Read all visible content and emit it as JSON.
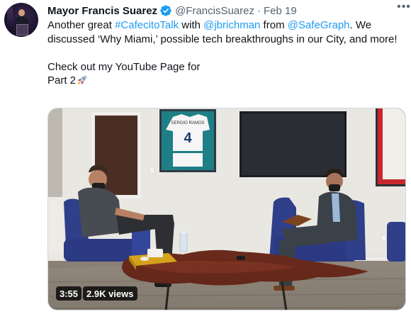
{
  "author": {
    "display_name": "Mayor Francis Suarez",
    "handle": "@FrancisSuarez",
    "separator": "·",
    "date": "Feb 19",
    "verified_icon": "verified-badge-icon",
    "avatar_icon": "profile-avatar"
  },
  "more_icon": "more-horizontal-icon",
  "tweet": {
    "line1_pre": "Another great ",
    "hashtag": "#CafecitoTalk",
    "line1_mid": " with ",
    "mention1": "@jbrichman",
    "line1_mid2": " from ",
    "mention2": "@SafeGraph",
    "line1_post": ". We discussed ‘Why Miami,’ possible tech breakthroughs in our City, and more!",
    "line2": "Check out my YouTube Page for",
    "line3": "Part 2",
    "emoji": "rocket-emoji"
  },
  "video": {
    "duration": "3:55",
    "views": "2.9K views",
    "jersey_name": "SERGIO RAMOS",
    "jersey_number": "4"
  },
  "colors": {
    "link": "#1d9bf0",
    "text": "#0f1419",
    "secondary": "#536471"
  }
}
